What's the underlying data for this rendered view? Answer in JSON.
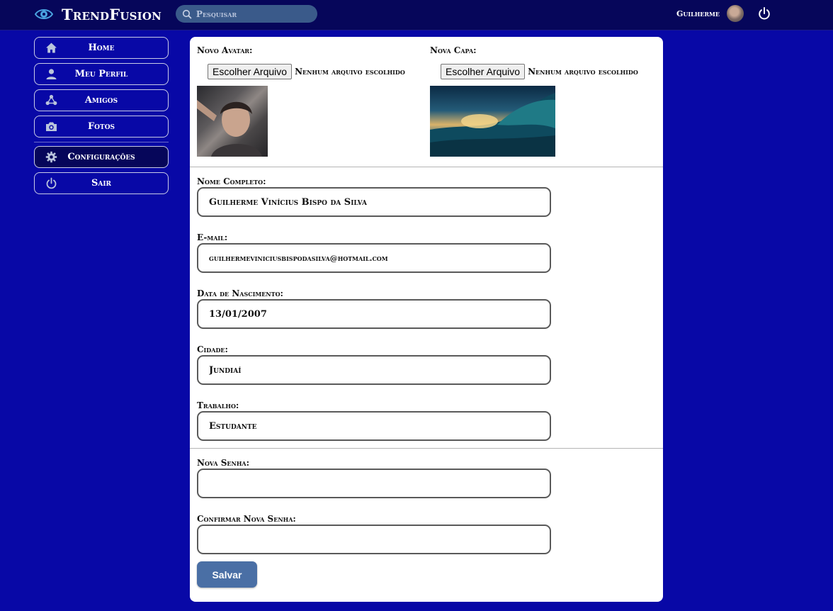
{
  "app": {
    "title": "TrendFusion"
  },
  "search": {
    "placeholder": "Pesquisar"
  },
  "user": {
    "name": "Guilherme"
  },
  "sidebar": {
    "items": [
      {
        "label": "Home",
        "icon": "home-icon"
      },
      {
        "label": "Meu Perfil",
        "icon": "user-icon"
      },
      {
        "label": "Amigos",
        "icon": "friends-icon"
      },
      {
        "label": "Fotos",
        "icon": "camera-icon"
      },
      {
        "label": "Configurações",
        "icon": "gear-icon",
        "active": true
      },
      {
        "label": "Sair",
        "icon": "power-icon"
      }
    ]
  },
  "uploads": {
    "avatar": {
      "label": "Novo Avatar:",
      "button": "Escolher Arquivo",
      "status": "Nenhum arquivo escolhido"
    },
    "cover": {
      "label": "Nova Capa:",
      "button": "Escolher Arquivo",
      "status": "Nenhum arquivo escolhido"
    }
  },
  "form": {
    "full_name": {
      "label": "Nome Completo:",
      "value": "Guilherme Vinícius Bispo da Silva"
    },
    "email": {
      "label": "E-mail:",
      "value": "guilhermeviniciusbispodasilva@hotmail.com"
    },
    "birth_date": {
      "label": "Data de Nascimento:",
      "value": "13/01/2007"
    },
    "city": {
      "label": "Cidade:",
      "value": "Jundiaí"
    },
    "work": {
      "label": "Trabalho:",
      "value": "Estudante"
    },
    "new_password": {
      "label": "Nova Senha:",
      "value": ""
    },
    "confirm_password": {
      "label": "Confirmar Nova Senha:",
      "value": ""
    },
    "save_label": "Salvar"
  },
  "colors": {
    "background": "#0808a6",
    "topbar": "#06065a",
    "save_button": "#4a6fa5",
    "search_box": "#3a5a8a"
  }
}
